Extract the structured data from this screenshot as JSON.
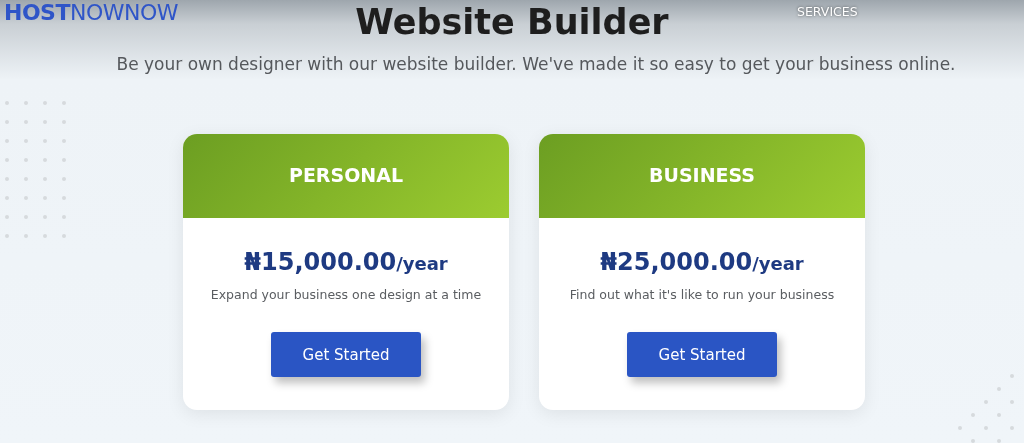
{
  "header": {
    "logo": {
      "bold": "HOST",
      "light": "NOWNOW"
    },
    "nav": [
      "SERVICES"
    ]
  },
  "hero": {
    "title": "Website Builder",
    "subtitle": "Be your own designer with our website builder. We've made it so easy to get your business online."
  },
  "plans": [
    {
      "name": "PERSONAL",
      "price": "₦15,000.00",
      "period": "/year",
      "description": "Expand your business one design at a time",
      "button": "Get Started"
    },
    {
      "name": "BUSINESS",
      "price": "₦25,000.00",
      "period": "/year",
      "description": "Find out what it's like to run your business",
      "button": "Get Started"
    }
  ]
}
